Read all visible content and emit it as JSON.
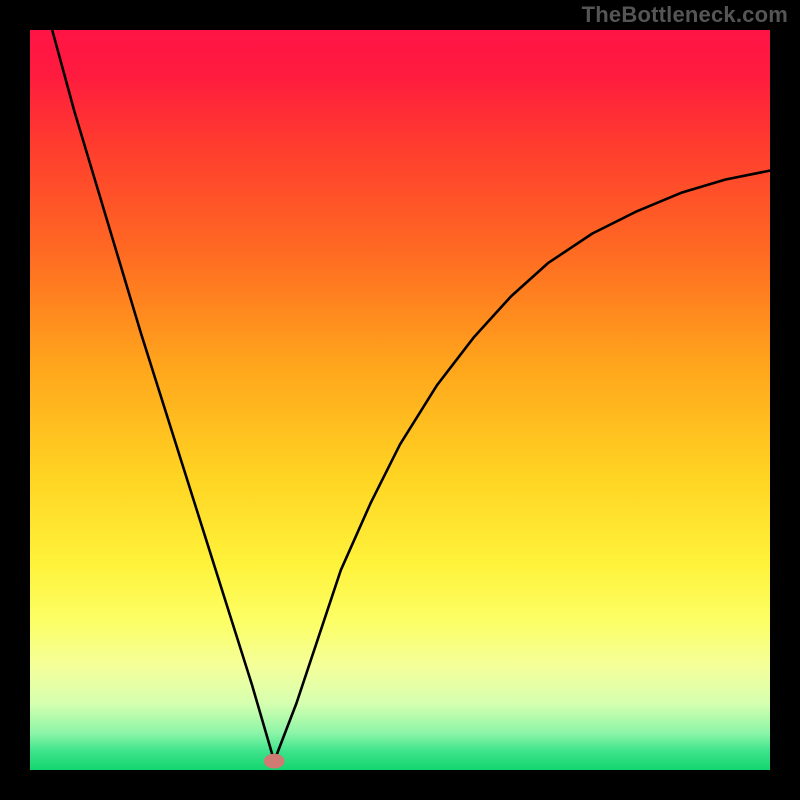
{
  "watermark": "TheBottleneck.com",
  "colors": {
    "frame": "#000000",
    "gradient_stops": [
      {
        "offset": 0.0,
        "color": "#ff1445"
      },
      {
        "offset": 0.06,
        "color": "#ff1b3f"
      },
      {
        "offset": 0.15,
        "color": "#ff3a2f"
      },
      {
        "offset": 0.3,
        "color": "#ff6a22"
      },
      {
        "offset": 0.45,
        "color": "#ffa41c"
      },
      {
        "offset": 0.6,
        "color": "#ffd322"
      },
      {
        "offset": 0.72,
        "color": "#fff23a"
      },
      {
        "offset": 0.8,
        "color": "#fcff66"
      },
      {
        "offset": 0.86,
        "color": "#f4ff9a"
      },
      {
        "offset": 0.91,
        "color": "#d6ffb0"
      },
      {
        "offset": 0.95,
        "color": "#8cf5a8"
      },
      {
        "offset": 0.975,
        "color": "#3de38a"
      },
      {
        "offset": 1.0,
        "color": "#12d66e"
      }
    ],
    "curve": "#000000",
    "marker": "#cf7a73"
  },
  "chart_data": {
    "type": "line",
    "title": "",
    "xlabel": "",
    "ylabel": "",
    "xlim": [
      0,
      100
    ],
    "ylim": [
      0,
      100
    ],
    "marker": {
      "x": 33,
      "y": 1.2,
      "rx": 1.4,
      "ry": 1.0
    },
    "series": [
      {
        "name": "bottleneck-curve",
        "x": [
          3,
          6,
          9,
          12,
          15,
          18,
          21,
          24,
          27,
          30,
          33,
          36,
          39,
          42,
          46,
          50,
          55,
          60,
          65,
          70,
          76,
          82,
          88,
          94,
          100
        ],
        "y": [
          100,
          89,
          79,
          69,
          59,
          49.5,
          40,
          30.5,
          21,
          11.5,
          1.2,
          9,
          18,
          27,
          36,
          44,
          52,
          58.5,
          64,
          68.5,
          72.5,
          75.5,
          78,
          79.8,
          81
        ]
      }
    ],
    "annotations": []
  }
}
